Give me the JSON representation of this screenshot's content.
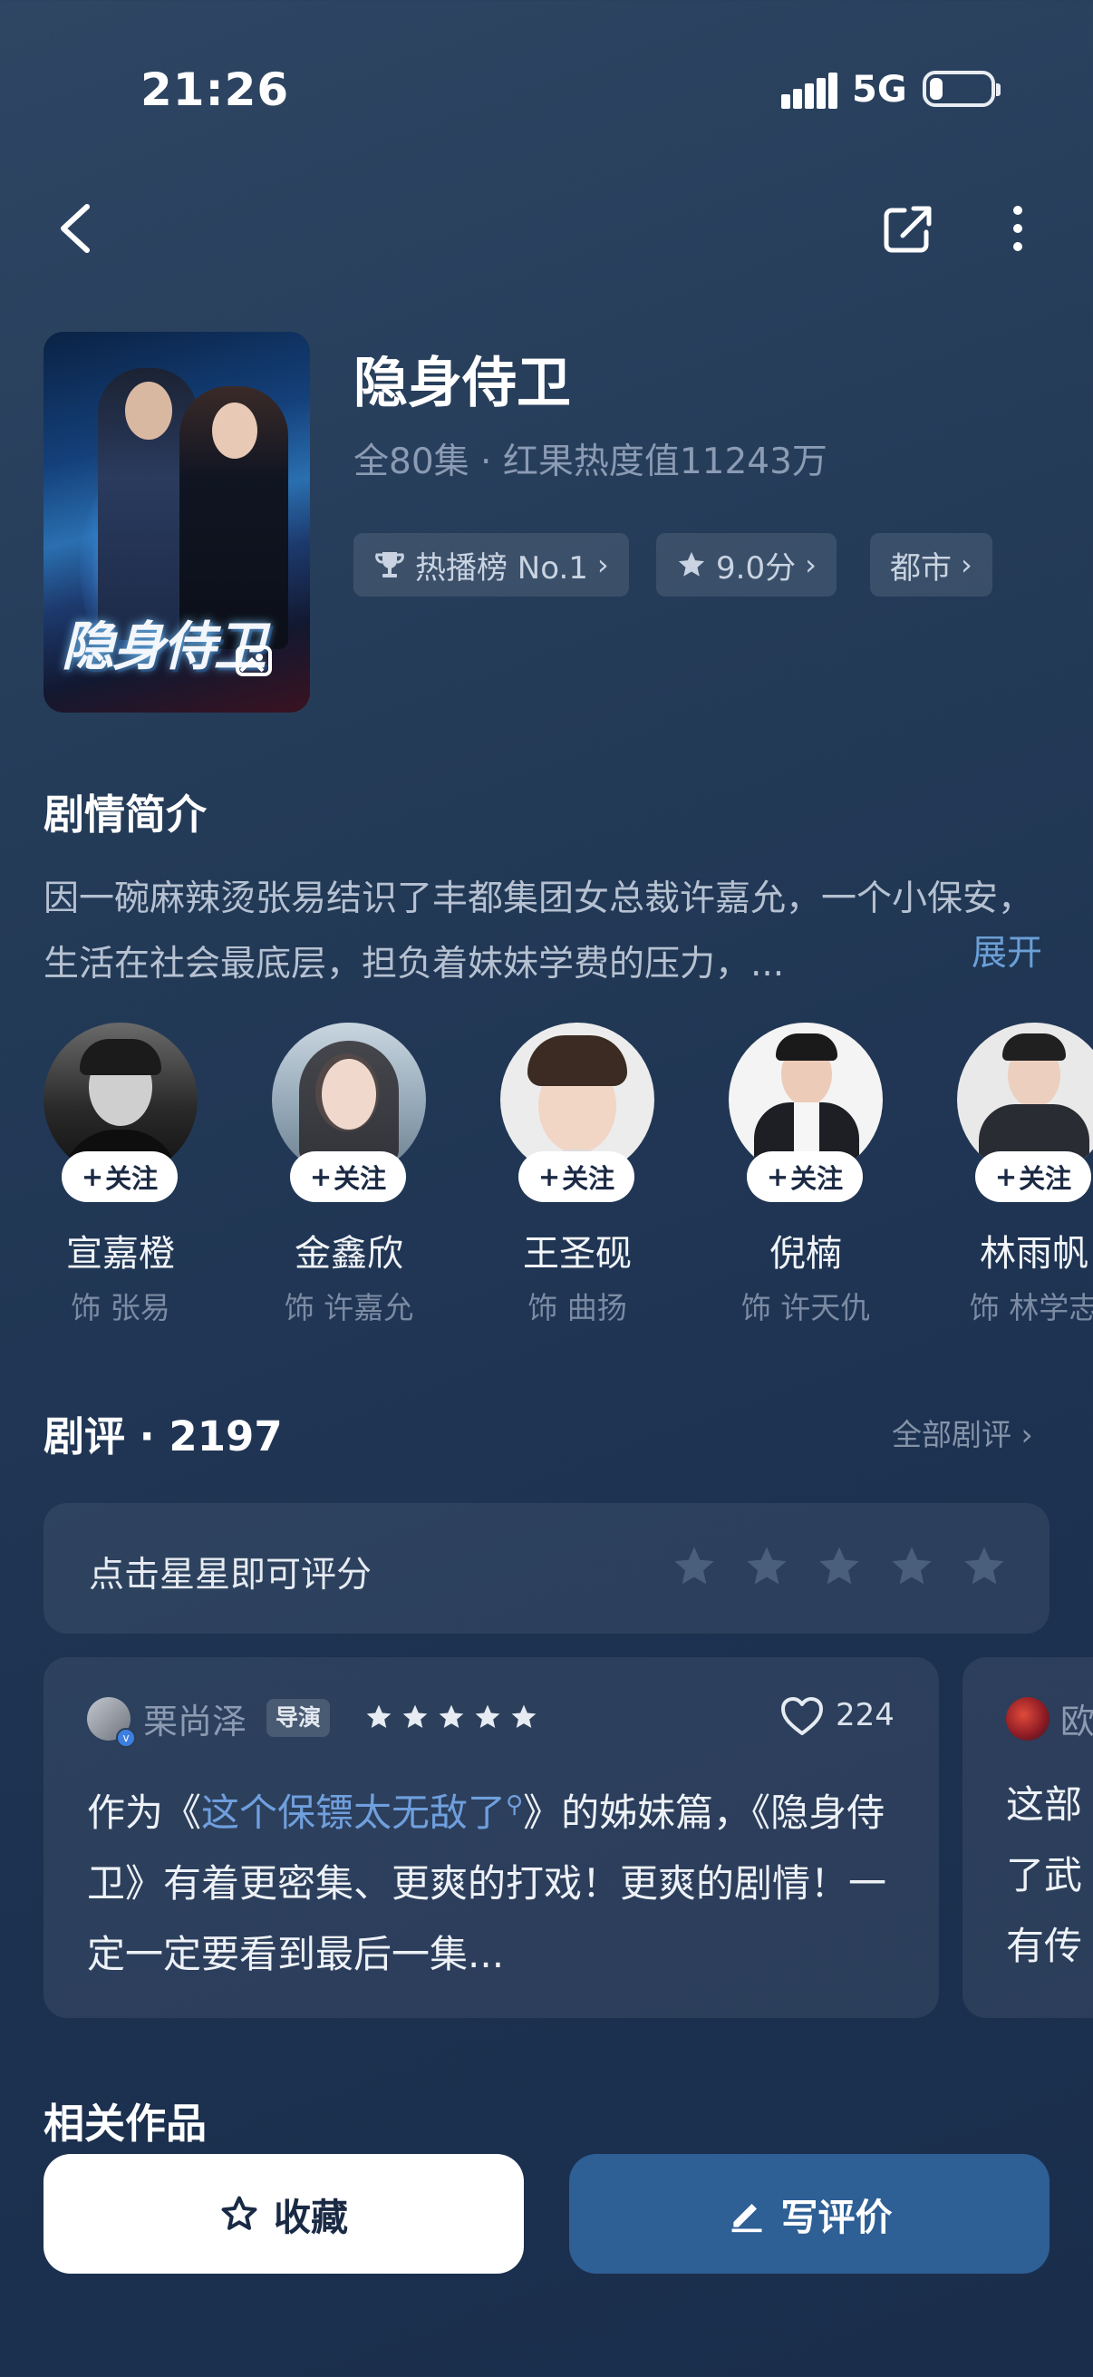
{
  "status_bar": {
    "time": "21:26",
    "network": "5G"
  },
  "drama": {
    "title": "隐身侍卫",
    "meta": "全80集 · 红果热度值11243万",
    "poster_title": "隐身侍卫",
    "chips": [
      {
        "label": "热播榜 No.1",
        "icon": "trophy-icon"
      },
      {
        "label": "9.0分",
        "icon": "star-icon"
      },
      {
        "label": "都市",
        "icon": ""
      }
    ]
  },
  "synopsis": {
    "title": "剧情简介",
    "text": "因一碗麻辣烫张易结识了丰都集团女总裁许嘉允，一个小保安，生活在社会最底层，担负着妹妹学费的压力，...",
    "expand_label": "展开"
  },
  "cast": {
    "follow_label": "关注",
    "items": [
      {
        "name": "宣嘉橙",
        "role": "饰 张易"
      },
      {
        "name": "金鑫欣",
        "role": "饰 许嘉允"
      },
      {
        "name": "王圣砚",
        "role": "饰 曲扬"
      },
      {
        "name": "倪楠",
        "role": "饰 许天仇"
      },
      {
        "name": "林雨帆",
        "role": "饰 林学志"
      }
    ]
  },
  "reviews": {
    "title": "剧评 · 2197",
    "all_label": "全部剧评 ›",
    "rate_prompt": "点击星星即可评分",
    "cards": [
      {
        "author": "栗尚泽",
        "tag": "导演",
        "rating": 5,
        "likes": "224",
        "text_before": "作为《",
        "link": "这个保镖太无敌了",
        "text_after": "》的姊妹篇，《隐身侍卫》有着更密集、更爽的打戏！更爽的剧情！一定一定要看到最后一集..."
      },
      {
        "author": "欧",
        "text": "这部\n了武\n有传"
      }
    ]
  },
  "related": {
    "title": "相关作品"
  },
  "actions": {
    "favorite_label": "收藏",
    "review_label": "写评价"
  },
  "colors": {
    "accent": "#6b9fd6",
    "primary_button": "#2e5f95",
    "background": "#233a57"
  }
}
